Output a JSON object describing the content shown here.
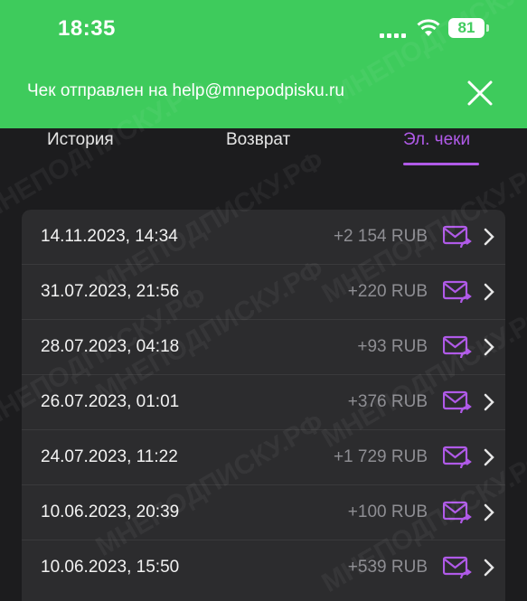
{
  "status_bar": {
    "time": "18:35",
    "battery": "81"
  },
  "notice": {
    "text": "Чек отправлен на help@mnepodpisku.ru"
  },
  "tabs": [
    {
      "label": "История"
    },
    {
      "label": "Возврат"
    },
    {
      "label": "Эл. чеки"
    }
  ],
  "receipts": [
    {
      "date": "14.11.2023, 14:34",
      "amount": "+2 154 RUB"
    },
    {
      "date": "31.07.2023, 21:56",
      "amount": "+220 RUB"
    },
    {
      "date": "28.07.2023, 04:18",
      "amount": "+93 RUB"
    },
    {
      "date": "26.07.2023, 01:01",
      "amount": "+376 RUB"
    },
    {
      "date": "24.07.2023, 11:22",
      "amount": "+1 729 RUB"
    },
    {
      "date": "10.06.2023, 20:39",
      "amount": "+100 RUB"
    },
    {
      "date": "10.06.2023, 15:50",
      "amount": "+539 RUB"
    }
  ],
  "watermark": "МНЕПОДПИСКУ.РФ",
  "colors": {
    "banner": "#3ecb5c",
    "accent": "#b05ae8",
    "card": "#2c2c2e",
    "background": "#1c1c1e"
  },
  "icons": {
    "close": "close-icon",
    "mail": "mail-send-icon",
    "chevron": "chevron-right-icon"
  }
}
